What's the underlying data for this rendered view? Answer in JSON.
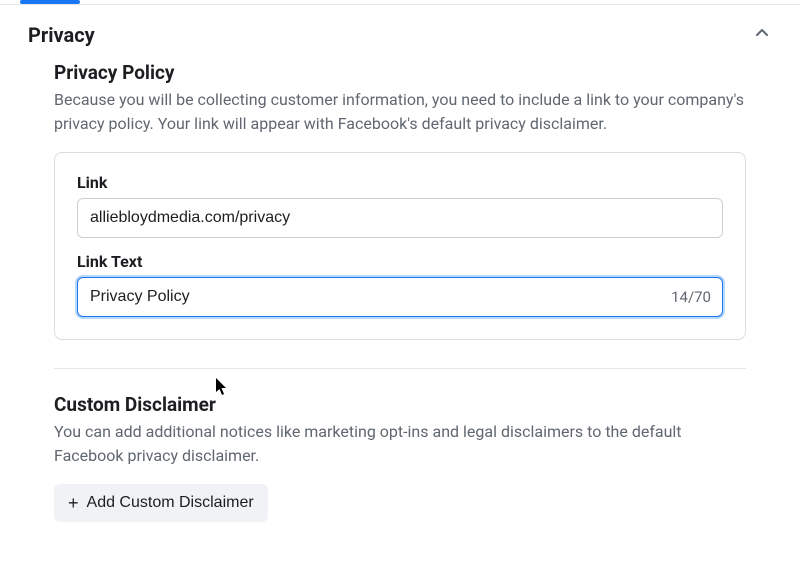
{
  "section": {
    "title": "Privacy"
  },
  "privacyPolicy": {
    "heading": "Privacy Policy",
    "description": "Because you will be collecting customer information, you need to include a link to your company's privacy policy. Your link will appear with Facebook's default privacy disclaimer.",
    "linkLabel": "Link",
    "linkValue": "alliebloydmedia.com/privacy",
    "linkTextLabel": "Link Text",
    "linkTextValue": "Privacy Policy",
    "charCounter": "14/70"
  },
  "customDisclaimer": {
    "heading": "Custom Disclaimer",
    "description": "You can add additional notices like marketing opt-ins and legal disclaimers to the default Facebook privacy disclaimer.",
    "addButton": "Add Custom Disclaimer"
  }
}
